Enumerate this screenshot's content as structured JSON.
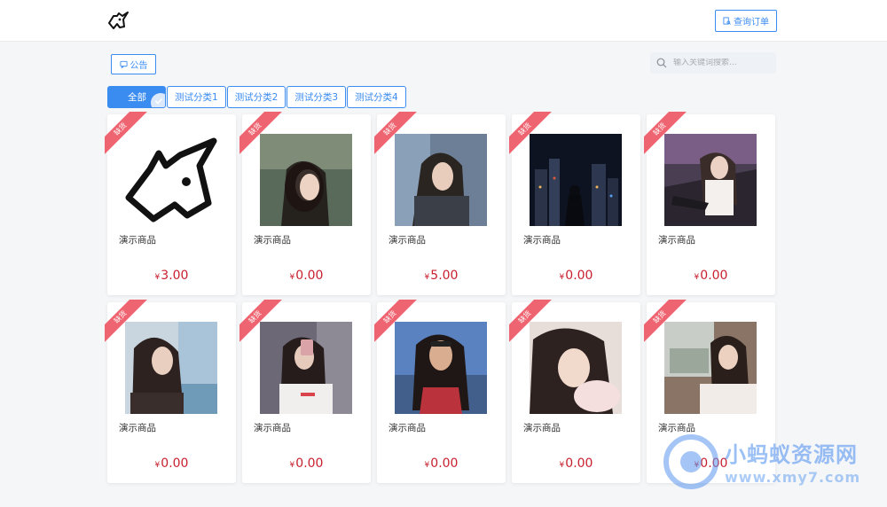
{
  "header": {
    "logo_icon": "unicorn-logo-icon",
    "order_button_label": "查询订单",
    "order_button_icon": "document-search-icon"
  },
  "toolbar": {
    "notice_label": "公告",
    "notice_icon": "message-icon",
    "search_placeholder": "输入关键词搜索..."
  },
  "tabs": [
    {
      "label": "全部",
      "active": true
    },
    {
      "label": "测试分类1",
      "active": false
    },
    {
      "label": "测试分类2",
      "active": false
    },
    {
      "label": "测试分类3",
      "active": false
    },
    {
      "label": "测试分类4",
      "active": false
    }
  ],
  "products": [
    {
      "badge": "缺货",
      "name": "演示商品",
      "currency": "¥",
      "price": "3.00",
      "image": "unicorn-logo"
    },
    {
      "badge": "缺货",
      "name": "演示商品",
      "currency": "¥",
      "price": "0.00",
      "image": "portrait-photo"
    },
    {
      "badge": "缺货",
      "name": "演示商品",
      "currency": "¥",
      "price": "5.00",
      "image": "portrait-photo"
    },
    {
      "badge": "缺货",
      "name": "演示商品",
      "currency": "¥",
      "price": "0.00",
      "image": "city-night-photo"
    },
    {
      "badge": "缺货",
      "name": "演示商品",
      "currency": "¥",
      "price": "0.00",
      "image": "car-interior-photo"
    },
    {
      "badge": "缺货",
      "name": "演示商品",
      "currency": "¥",
      "price": "0.00",
      "image": "seaside-portrait-photo"
    },
    {
      "badge": "缺货",
      "name": "演示商品",
      "currency": "¥",
      "price": "0.00",
      "image": "mirror-selfie-photo"
    },
    {
      "badge": "缺货",
      "name": "演示商品",
      "currency": "¥",
      "price": "0.00",
      "image": "sky-portrait-photo"
    },
    {
      "badge": "缺货",
      "name": "演示商品",
      "currency": "¥",
      "price": "0.00",
      "image": "portrait-photo"
    },
    {
      "badge": "缺货",
      "name": "演示商品",
      "currency": "¥",
      "price": "0.00",
      "image": "car-window-photo"
    }
  ],
  "watermark": {
    "title": "小蚂蚁资源网",
    "url": "www.xmy7.com"
  },
  "colors": {
    "accent": "#3b8cf0",
    "price": "#c8202e",
    "ribbon": "#ee6470"
  }
}
